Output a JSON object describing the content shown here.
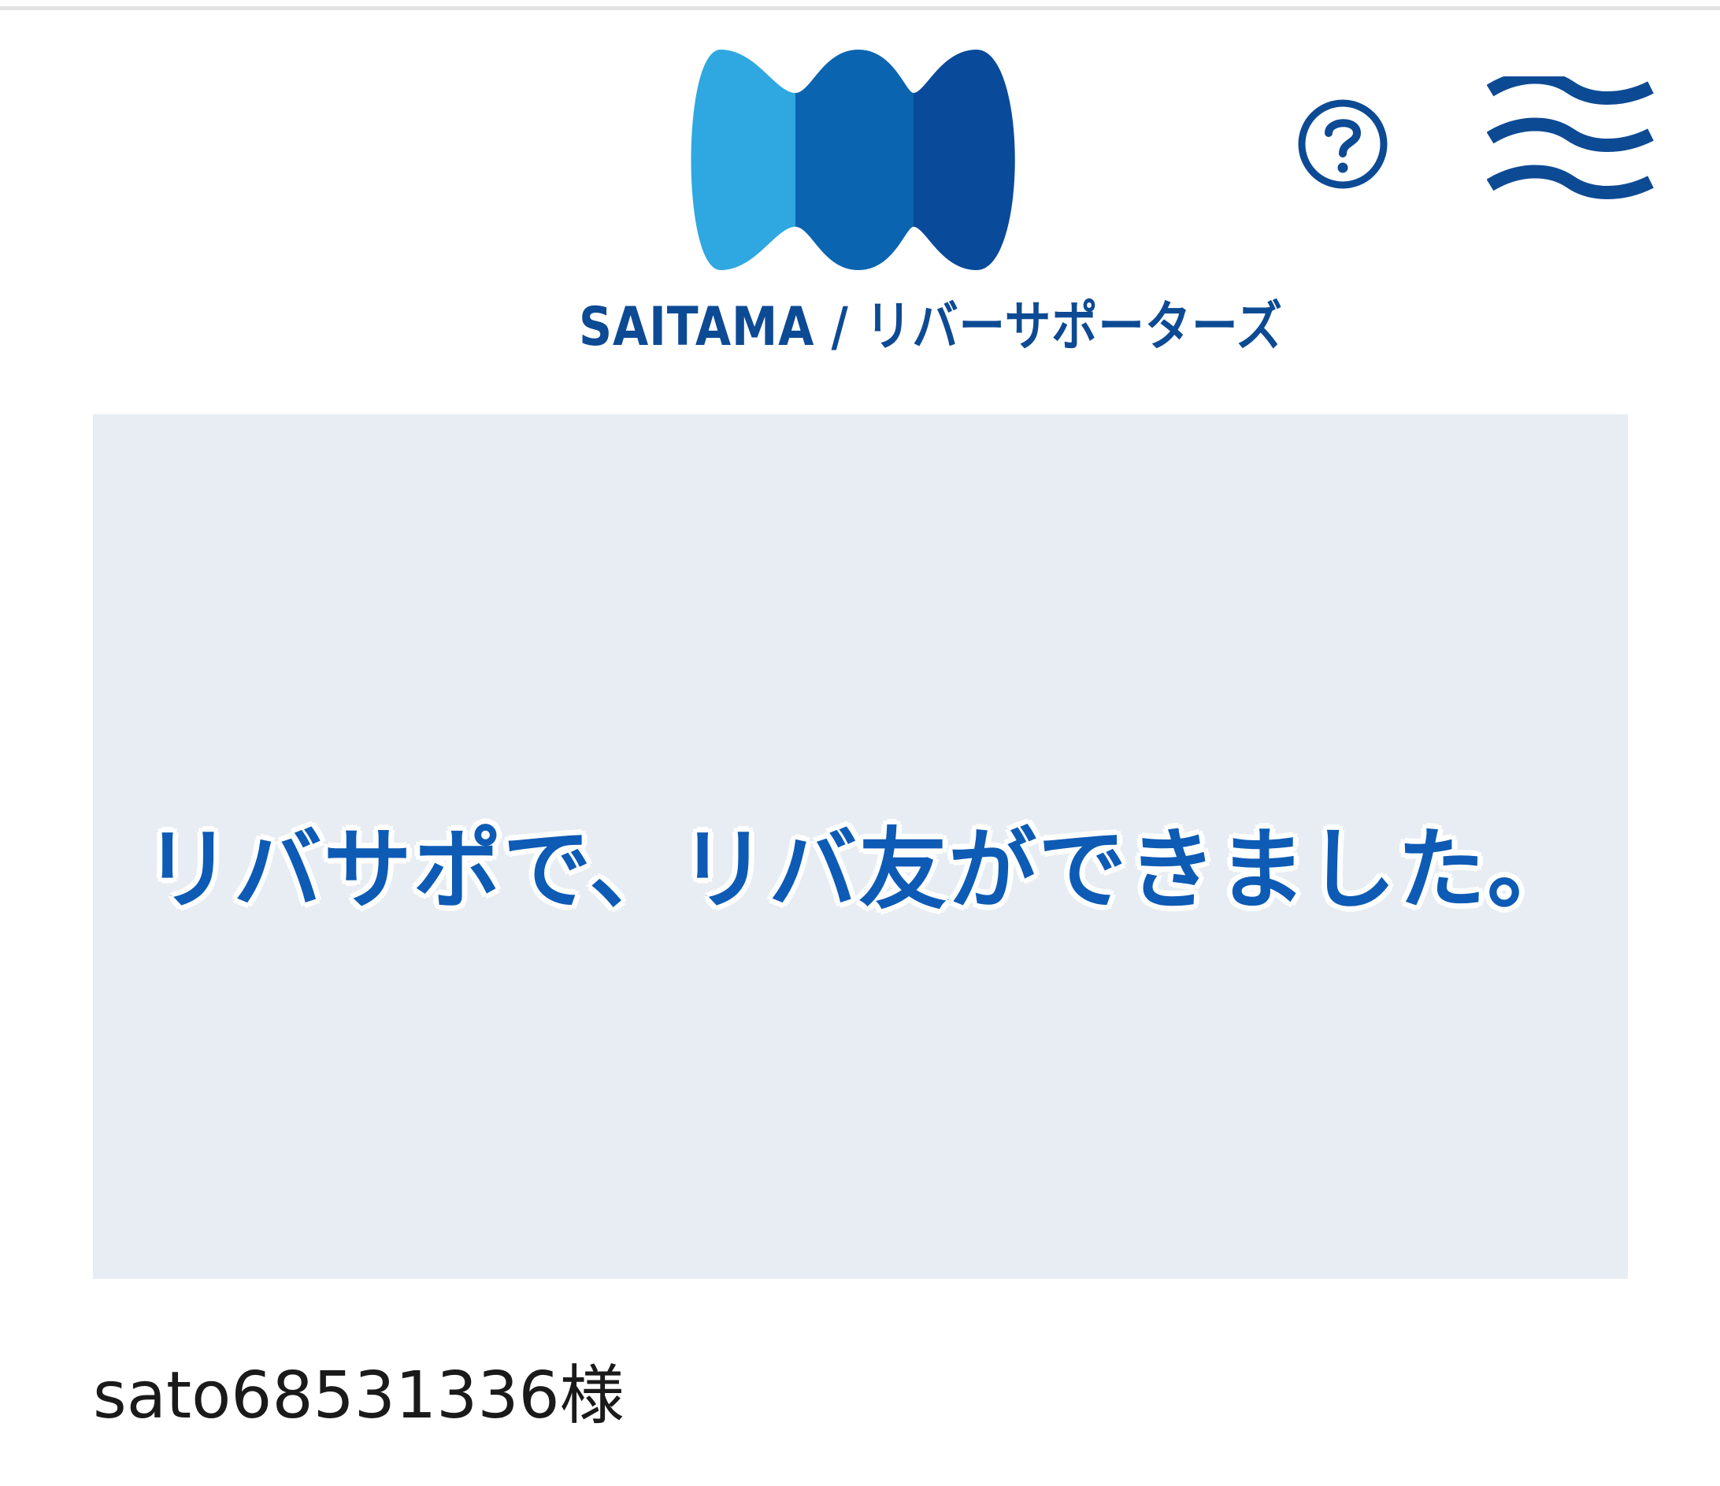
{
  "header": {
    "logo_text": "SAITAMA / リバーサポーターズ",
    "logo_colors": [
      "#2fa7e0",
      "#0b64b0",
      "#0a4a9a"
    ],
    "help_icon": "question-circle-icon",
    "menu_icon": "wave-menu-icon",
    "accent_color": "#0d4a94"
  },
  "banner": {
    "message": "リバサポで、リバ友ができました。",
    "background": "#e7edf2"
  },
  "user": {
    "name": "sato68531336様"
  }
}
